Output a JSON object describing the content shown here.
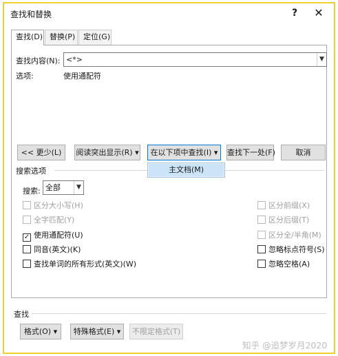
{
  "window": {
    "title": "查找和替换",
    "help_glyph": "?",
    "close_glyph": "✕"
  },
  "tabs": [
    {
      "label": "查找(D)",
      "active": true
    },
    {
      "label": "替换(P)",
      "active": false
    },
    {
      "label": "定位(G)",
      "active": false
    }
  ],
  "find": {
    "label": "查找内容(N):",
    "value": "<*>",
    "options_label": "选项:",
    "options_value": "使用通配符"
  },
  "buttons": {
    "less": "<< 更少(L)",
    "reading_highlight": "阅读突出显示(R) ▾",
    "find_in": "在以下项中查找(I) ▾",
    "find_next": "查找下一处(F)",
    "cancel": "取消"
  },
  "find_in_menu": {
    "items": [
      "主文档(M)"
    ]
  },
  "search_options": {
    "section_label": "搜索选项",
    "search_label": "搜索:",
    "search_value": "全部",
    "left": [
      {
        "label": "区分大小写(H)",
        "checked": false,
        "enabled": false
      },
      {
        "label": "全字匹配(Y)",
        "checked": false,
        "enabled": false
      },
      {
        "label": "使用通配符(U)",
        "checked": true,
        "enabled": true
      },
      {
        "label": "同音(英文)(K)",
        "checked": false,
        "enabled": true
      },
      {
        "label": "查找单词的所有形式(英文)(W)",
        "checked": false,
        "enabled": true
      }
    ],
    "right": [
      {
        "label": "区分前缀(X)",
        "checked": false,
        "enabled": false
      },
      {
        "label": "区分后缀(T)",
        "checked": false,
        "enabled": false
      },
      {
        "label": "区分全/半角(M)",
        "checked": false,
        "enabled": false
      },
      {
        "label": "忽略标点符号(S)",
        "checked": false,
        "enabled": true
      },
      {
        "label": "忽略空格(A)",
        "checked": false,
        "enabled": true
      }
    ]
  },
  "find_section": {
    "label": "查找",
    "format_button": "格式(O) ▾",
    "special_button": "特殊格式(E) ▾",
    "no_format_button": "不限定格式(T)"
  },
  "watermark": "知乎 @追梦岁月2020",
  "check_glyph": "✓"
}
